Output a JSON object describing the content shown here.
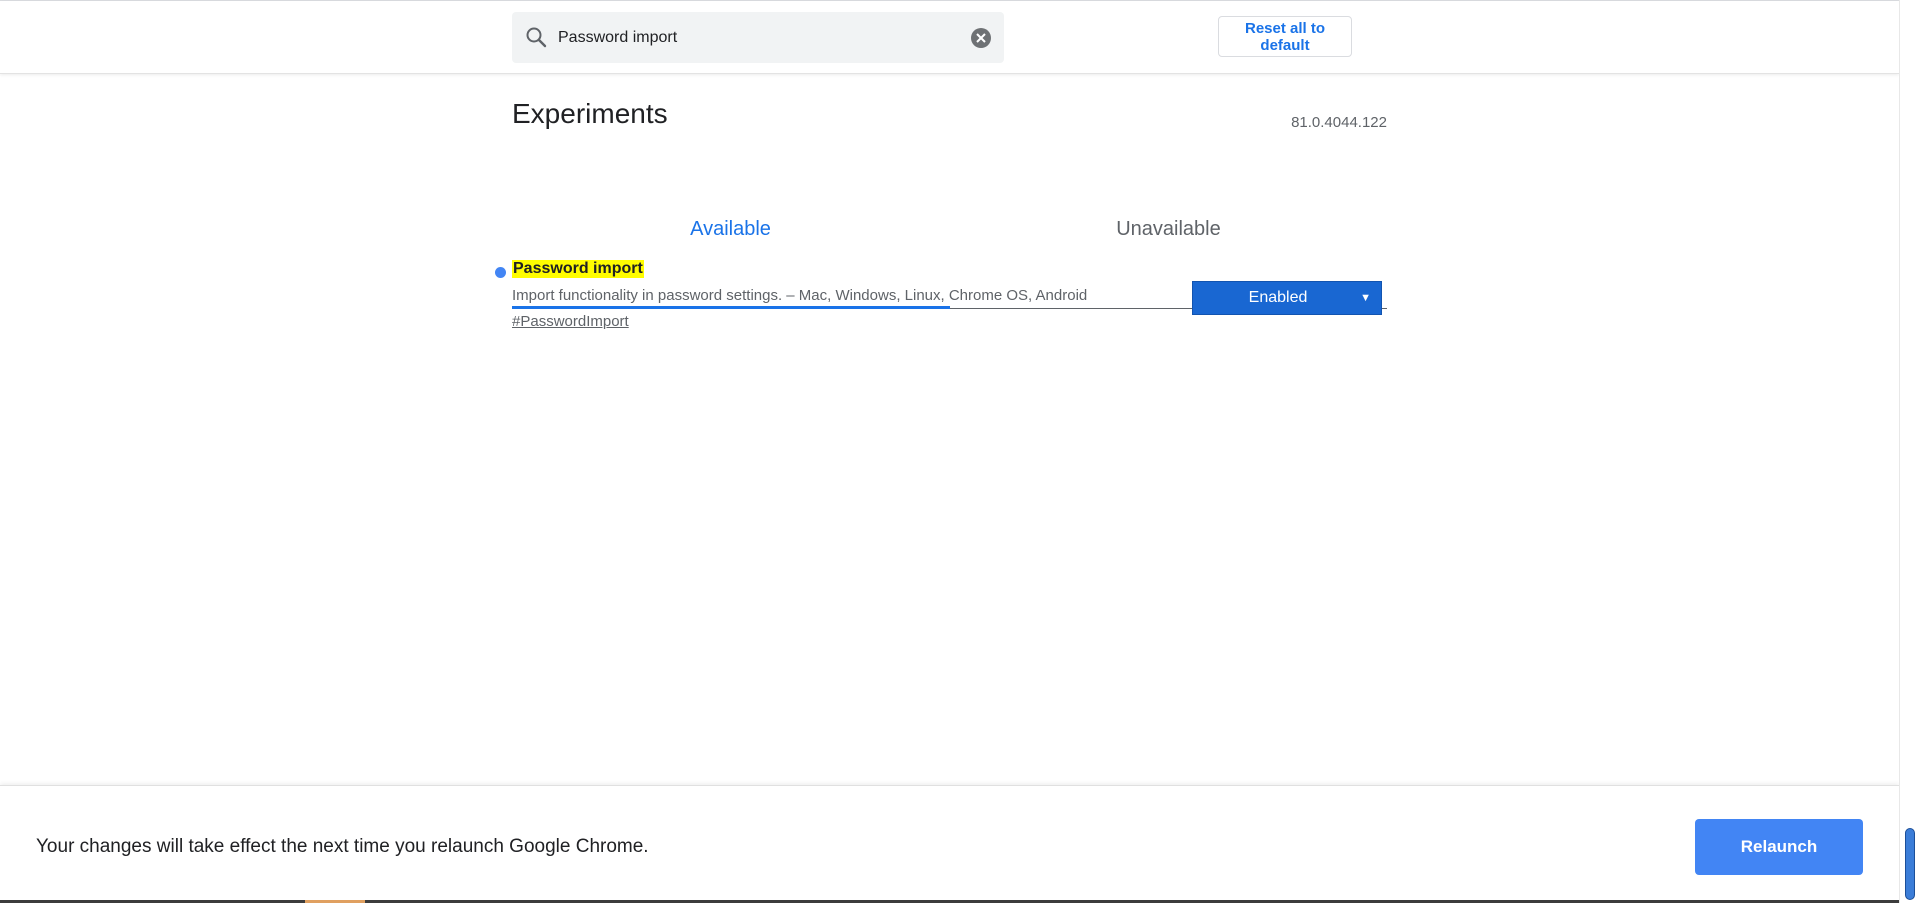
{
  "search": {
    "value": "Password import"
  },
  "header": {
    "reset_label": "Reset all to default"
  },
  "page": {
    "title": "Experiments",
    "version": "81.0.4044.122"
  },
  "tabs": [
    {
      "label": "Available",
      "selected": true
    },
    {
      "label": "Unavailable",
      "selected": false
    }
  ],
  "experiment": {
    "name": "Password import",
    "description": "Import functionality in password settings. – Mac, Windows, Linux, Chrome OS, Android",
    "link": "#PasswordImport",
    "state": "Enabled"
  },
  "footer": {
    "message": "Your changes will take effect the next time you relaunch Google Chrome.",
    "relaunch_label": "Relaunch"
  },
  "colors": {
    "accent": "#1a73e8",
    "select_bg": "#1967d2",
    "relaunch_bg": "#4285f4",
    "highlight": "#fffd00"
  }
}
